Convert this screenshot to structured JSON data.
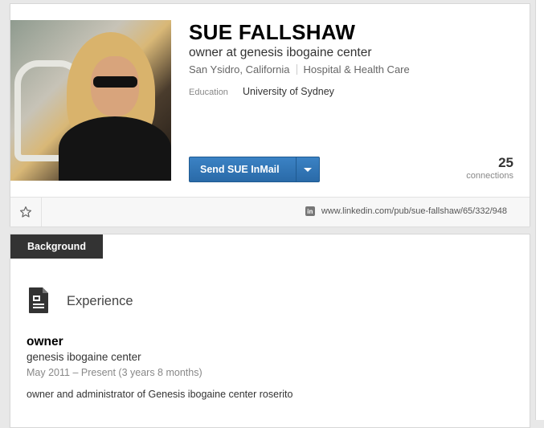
{
  "profile": {
    "name": "SUE FALLSHAW",
    "headline": "owner at genesis ibogaine center",
    "location": "San Ysidro, California",
    "industry": "Hospital & Health Care",
    "education_label": "Education",
    "education_value": "University of Sydney",
    "inmail_label": "Send SUE InMail",
    "connections_count": "25",
    "connections_label": "connections",
    "public_url": "www.linkedin.com/pub/sue-fallshaw/65/332/948"
  },
  "background": {
    "tab_label": "Background",
    "section_title": "Experience",
    "job": {
      "title": "owner",
      "company": "genesis ibogaine center",
      "dates": "May 2011 – Present (3 years 8 months)",
      "description": "owner and administrator of Genesis ibogaine center roserito"
    }
  },
  "colors": {
    "inmail_button": "#2a6aa8",
    "tab_background": "#333333"
  },
  "icons": {
    "favorite": "star-icon",
    "linkedin": "linkedin-icon",
    "experience": "document-icon",
    "dropdown": "chevron-down-icon"
  }
}
